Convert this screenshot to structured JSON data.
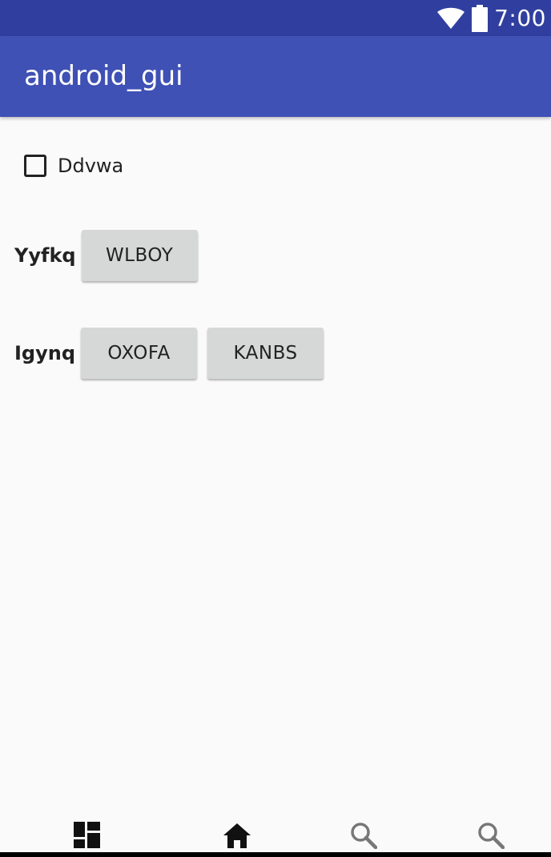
{
  "status_bar": {
    "time": "7:00",
    "wifi_icon": "wifi-icon",
    "battery_icon": "battery-icon",
    "background_color": "#303f9f"
  },
  "app_bar": {
    "title": "android_gui",
    "background_color": "#3f51b5"
  },
  "checkbox": {
    "label": "Ddvwa",
    "checked": false
  },
  "rows": [
    {
      "label": "Yyfkq",
      "buttons": [
        "WLBOY"
      ]
    },
    {
      "label": "Igynq",
      "buttons": [
        "OXOFA",
        "KANBS"
      ]
    }
  ],
  "bottom_nav": {
    "items": [
      {
        "icon": "dashboard-icon"
      },
      {
        "icon": "home-icon"
      },
      {
        "icon": "search-icon"
      },
      {
        "icon": "search-icon"
      }
    ]
  }
}
